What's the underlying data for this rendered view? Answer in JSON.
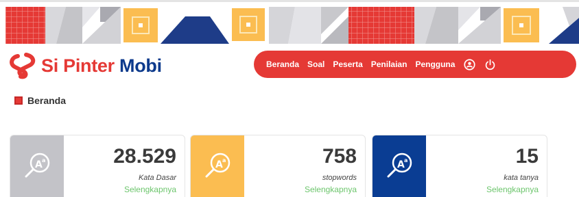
{
  "colors": {
    "brand_red": "#e53935",
    "brand_blue": "#0d3a8c",
    "card_gray": "#c3c3c8",
    "card_orange": "#fbbd51",
    "card_blue": "#0a3d93",
    "link_green": "#6cc56c"
  },
  "header": {
    "logo": {
      "part1": "Si Pinter",
      "part2": "Mobi",
      "icon": "sipinter-logo-icon"
    },
    "nav": {
      "items": [
        {
          "label": "Beranda"
        },
        {
          "label": "Soal"
        },
        {
          "label": "Peserta"
        },
        {
          "label": "Penilaian"
        },
        {
          "label": "Pengguna"
        }
      ],
      "icons": [
        "user-circle-icon",
        "power-icon"
      ]
    }
  },
  "page": {
    "title": "Beranda"
  },
  "cards": [
    {
      "value": "28.529",
      "label": "Kata Dasar",
      "link": "Selengkapnya",
      "icon": "magnifier-font-icon"
    },
    {
      "value": "758",
      "label": "stopwords",
      "link": "Selengkapnya",
      "icon": "magnifier-font-icon"
    },
    {
      "value": "15",
      "label": "kata tanya",
      "link": "Selengkapnya",
      "icon": "magnifier-font-icon"
    }
  ]
}
